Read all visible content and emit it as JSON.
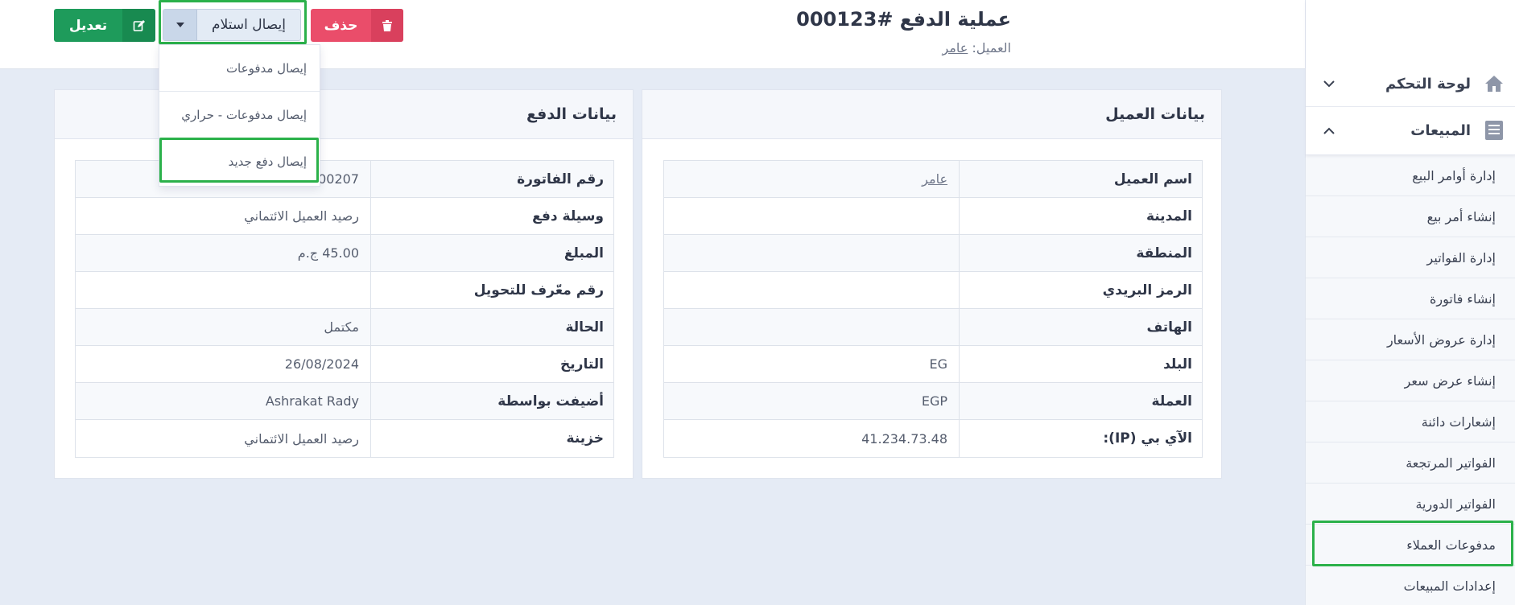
{
  "header": {
    "title": "عملية الدفع #000123",
    "client_label": "العميل:",
    "client_name": "عامر"
  },
  "buttons": {
    "edit_label": "تعديل",
    "receipt_label": "إيصال استلام",
    "delete_label": "حذف"
  },
  "dropdown": {
    "items": [
      "إيصال مدفوعات",
      "إيصال مدفوعات - حراري",
      "إيصال دفع جديد"
    ]
  },
  "customer_panel": {
    "title": "بيانات العميل",
    "rows": [
      {
        "label": "اسم العميل",
        "value": "عامر"
      },
      {
        "label": "المدينة",
        "value": ""
      },
      {
        "label": "المنطقة",
        "value": ""
      },
      {
        "label": "الرمز البريدي",
        "value": ""
      },
      {
        "label": "الهاتف",
        "value": ""
      },
      {
        "label": "البلد",
        "value": "EG"
      },
      {
        "label": "العملة",
        "value": "EGP"
      },
      {
        "label": "الآي بي (IP):",
        "value": "41.234.73.48"
      }
    ]
  },
  "payment_panel": {
    "title": "بيانات الدفع",
    "rows": [
      {
        "label": "رقم الفاتورة",
        "value": "00207"
      },
      {
        "label": "وسيلة دفع",
        "value": "رصيد العميل الائتماني"
      },
      {
        "label": "المبلغ",
        "value": "45.00 ج.م"
      },
      {
        "label": "رقم معّرف للتحويل",
        "value": ""
      },
      {
        "label": "الحالة",
        "value": "مكتمل"
      },
      {
        "label": "التاريخ",
        "value": "26/08/2024"
      },
      {
        "label": "أضيفت بواسطة",
        "value": "Ashrakat Rady"
      },
      {
        "label": "خزينة",
        "value": "رصيد العميل الائتماني"
      }
    ]
  },
  "sidebar": {
    "dashboard_label": "لوحة التحكم",
    "sales_label": "المبيعات",
    "items": [
      "إدارة أوامر البيع",
      "إنشاء أمر بيع",
      "إدارة الفواتير",
      "إنشاء فاتورة",
      "إدارة عروض الأسعار",
      "إنشاء عرض سعر",
      "إشعارات دائنة",
      "الفواتير المرتجعة",
      "الفواتير الدورية",
      "مدفوعات العملاء",
      "إعدادات المبيعات"
    ]
  },
  "colors": {
    "accent_green": "#1e9b5b",
    "danger": "#ea4d6a",
    "highlight_frame": "#2bb14a"
  }
}
